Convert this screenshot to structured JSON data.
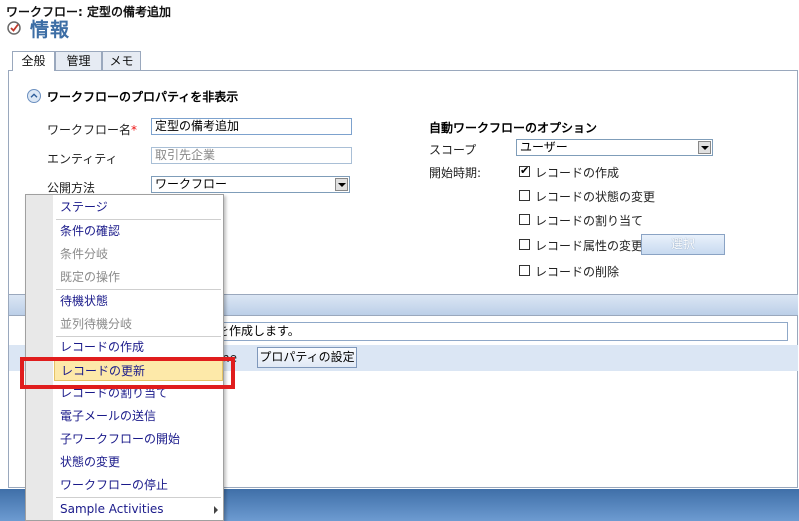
{
  "header": {
    "title": "ワークフロー: 定型の備考追加",
    "heading": "情報"
  },
  "tabs": [
    {
      "label": "全般"
    },
    {
      "label": "管理"
    },
    {
      "label": "メモ"
    }
  ],
  "section": {
    "toggle_label": "ワークフローのプロパティを非表示"
  },
  "form": {
    "name_label": "ワークフロー名",
    "name_value": "定型の備考追加",
    "entity_label": "エンティティ",
    "entity_value": "取引先企業",
    "publish_label": "公開方法",
    "publish_value": "ワークフロー"
  },
  "auto": {
    "title": "自動ワークフローのオプション",
    "scope_label": "スコープ",
    "scope_value": "ユーザー",
    "start_label": "開始時期:",
    "options": [
      {
        "label": "レコードの作成",
        "checked": true
      },
      {
        "label": "レコードの状態の変更",
        "checked": false
      },
      {
        "label": "レコードの割り当て",
        "checked": false
      },
      {
        "label": "レコード属性の変更",
        "checked": false
      },
      {
        "label": "レコードの削除",
        "checked": false
      }
    ],
    "select_button": "選択"
  },
  "steps": {
    "description_value": "列を作成します。",
    "partial_text": "ne",
    "properties_button": "プロパティの設定"
  },
  "menu": {
    "items": [
      {
        "label": "ステージ",
        "disabled": false
      },
      {
        "label": "条件の確認",
        "disabled": false
      },
      {
        "label": "条件分岐",
        "disabled": true
      },
      {
        "label": "既定の操作",
        "disabled": true
      },
      {
        "label": "待機状態",
        "disabled": false
      },
      {
        "label": "並列待機分岐",
        "disabled": true
      },
      {
        "label": "レコードの作成",
        "disabled": false
      },
      {
        "label": "レコードの更新",
        "disabled": false
      },
      {
        "label": "レコードの割り当て",
        "disabled": false
      },
      {
        "label": "電子メールの送信",
        "disabled": false
      },
      {
        "label": "子ワークフローの開始",
        "disabled": false
      },
      {
        "label": "状態の変更",
        "disabled": false
      },
      {
        "label": "ワークフローの停止",
        "disabled": false
      },
      {
        "label": "Sample Activities",
        "disabled": false
      }
    ]
  },
  "colors": {
    "highlight_border": "#e01d1d",
    "accent": "#3d6ea5"
  }
}
